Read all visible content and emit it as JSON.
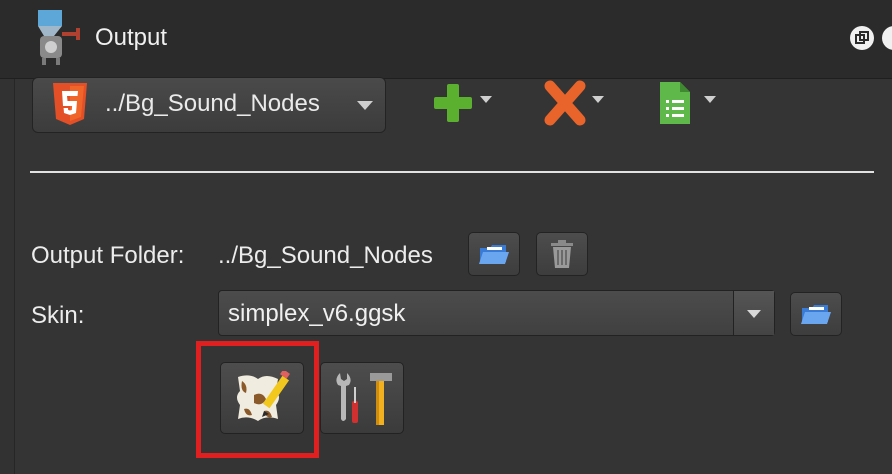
{
  "window": {
    "title": "Output"
  },
  "toolbar": {
    "format_select": {
      "label": "../Bg_Sound_Nodes"
    },
    "add_icon": "plus-icon",
    "remove_icon": "x-icon",
    "doc_icon": "document-icon"
  },
  "fields": {
    "output_folder_label": "Output Folder:",
    "output_folder_value": "../Bg_Sound_Nodes",
    "skin_label": "Skin:",
    "skin_value": "simplex_v6.ggsk"
  },
  "colors": {
    "highlight": "#e02020",
    "add_green": "#5cb030",
    "remove_orange": "#e8642a",
    "doc_green": "#5fb84a"
  }
}
